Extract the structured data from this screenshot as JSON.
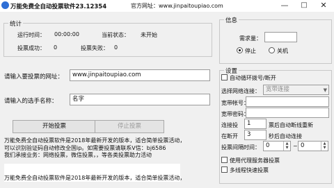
{
  "window": {
    "title": "万能免费全自动投票软件23.12354",
    "site": "官方网址：www.jinpaitoupiao.com",
    "controls": {
      "minimize": "—",
      "maximize": "□",
      "close": "✕"
    }
  },
  "stats": {
    "group_label": "统计",
    "run_time_label": "运行时间：",
    "run_time_value": "00:00:00",
    "state_label": "当前状态：",
    "state_value": "未开始",
    "success_label": "投票成功：",
    "success_value": "0",
    "fail_label": "投票失败：",
    "fail_value": "0"
  },
  "info": {
    "group_label": "信息",
    "need_label": "需求量：",
    "need_value": "",
    "stop_label": "停止",
    "shutdown_label": "关机",
    "selected": "stop"
  },
  "form": {
    "url_label": "请输入要投票的网址：",
    "url_value": "www.jinpaitoupiao.com",
    "name_label": "请输入的选手名称：",
    "name_value": "名字",
    "start_button": "开始投票",
    "stop_button": "停止投票"
  },
  "notice": {
    "lines": [
      "万能免费全自动投票软件是2018年最新开发的版本，适合简单投票活动，",
      "可以识别验证码自动修改全国ip。如需要投票请联系V信：bj6586",
      "我们承接业务：网络投票，微信投票，，等各类投票助力活动"
    ],
    "bottom_lines": [
      "万能免费全自动投票软件是2018年最新开发的版本，适合简单投票活动，"
    ]
  },
  "settings": {
    "group_label": "设置",
    "auto_dial_label": "自动循环拨号/断开",
    "net_conn_label": "选择网络连接：",
    "net_conn_value": "宽带连接",
    "account_label": "宽带帐号：",
    "password_label": "宽带密码：",
    "connect_label": "连接投",
    "connect_value": "1",
    "connect_suffix": "票后自动断线重新",
    "disconnect_label": "在断开",
    "disconnect_value": "3",
    "disconnect_suffix": "秒后自动连接",
    "interval_label": "投票间隔时间：",
    "interval_from": "0",
    "interval_sep": "~",
    "interval_to": "0",
    "proxy_label": "使用代理服务器投票",
    "multi_label": "多线程快速投票"
  }
}
